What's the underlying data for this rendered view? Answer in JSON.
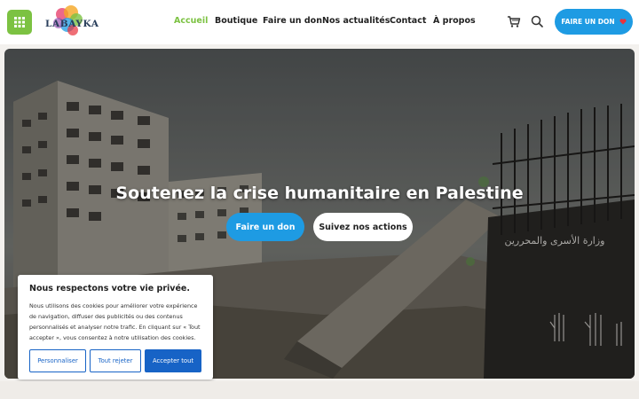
{
  "header": {
    "menu_icon": "grid-icon",
    "logo_text": "LABAYKA",
    "nav": [
      {
        "label": "Accueil",
        "active": true
      },
      {
        "label": "Boutique",
        "active": false
      },
      {
        "label": "Faire un don",
        "active": false
      },
      {
        "label": "Nos actualités",
        "active": false
      },
      {
        "label": "Contact",
        "active": false
      },
      {
        "label": "À propos",
        "active": false
      }
    ],
    "cart_icon": "cart-icon",
    "search_icon": "search-icon",
    "donate_button": "FAIRE UN DON",
    "donate_icon": "heart-icon"
  },
  "hero": {
    "title": "Soutenez la crise humanitaire en Palestine",
    "primary_button": "Faire un don",
    "secondary_button": "Suivez nos actions",
    "wall_text": "وزارة الأسرى والمحررين"
  },
  "cookie": {
    "title": "Nous respectons votre vie privée.",
    "text": "Nous utilisons des cookies pour améliorer votre expérience de navigation, diffuser des publicités ou des contenus personnalisés et analyser notre trafic. En cliquant sur « Tout accepter », vous consentez à notre utilisation des cookies.",
    "customize": "Personnaliser",
    "reject": "Tout rejeter",
    "accept": "Accepter tout"
  },
  "colors": {
    "accent_green": "#7cc242",
    "primary_blue": "#1e9be3",
    "cookie_blue": "#1763c6",
    "heart_red": "#e8323c"
  }
}
